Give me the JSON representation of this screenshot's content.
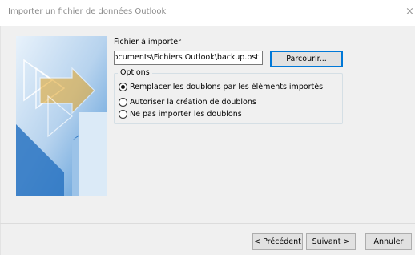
{
  "window": {
    "title": "Importer un fichier de données Outlook",
    "close_glyph": "×"
  },
  "file_section": {
    "label": "Fichier à importer",
    "path_value": "Documents\\Fichiers Outlook\\backup.pst",
    "browse_label": "Parcourir..."
  },
  "options": {
    "legend": "Options",
    "items": [
      {
        "label": "Remplacer les doublons par les éléments importés",
        "checked": true
      },
      {
        "label": "Autoriser la création de doublons",
        "checked": false
      },
      {
        "label": "Ne pas importer les doublons",
        "checked": false
      }
    ]
  },
  "footer": {
    "back_label": "< Précédent",
    "next_label": "Suivant >",
    "cancel_label": "Annuler"
  },
  "colors": {
    "banner_blue": "#2f7cc7",
    "default_button_border": "#0078d7"
  },
  "icons": {
    "banner": "import-wizard-arrows-illustration",
    "close": "close-icon"
  }
}
